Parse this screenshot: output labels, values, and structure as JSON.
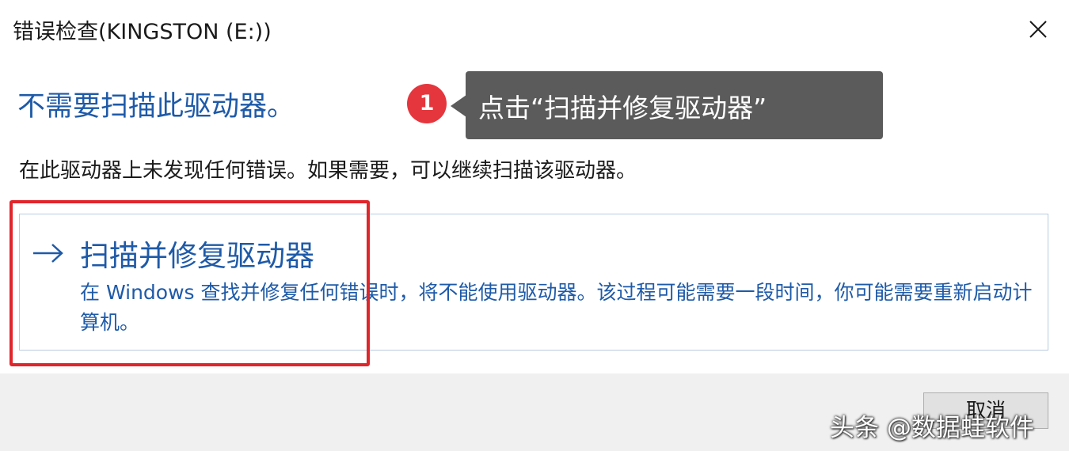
{
  "window": {
    "title": "错误检查(KINGSTON (E:))",
    "close_icon": "close-icon"
  },
  "main": {
    "heading": "不需要扫描此驱动器。",
    "description": "在此驱动器上未发现任何错误。如果需要，可以继续扫描该驱动器。"
  },
  "option": {
    "arrow_icon": "arrow-right-icon",
    "title": "扫描并修复驱动器",
    "subtitle": "在 Windows 查找并修复任何错误时，将不能使用驱动器。该过程可能需要一段时间，你可能需要重新启动计算机。"
  },
  "annotation": {
    "step_number": "1",
    "tooltip_text": "点击“扫描并修复驱动器”",
    "badge_color": "#e5363d",
    "highlight_color": "#e0252b"
  },
  "footer": {
    "cancel_label": "取消"
  },
  "watermark": {
    "text": "头条 @数据蛙软件"
  },
  "colors": {
    "accent": "#1e5aa8",
    "tooltip_bg": "#5b5b5b",
    "footer_bg": "#f0f0f0"
  }
}
